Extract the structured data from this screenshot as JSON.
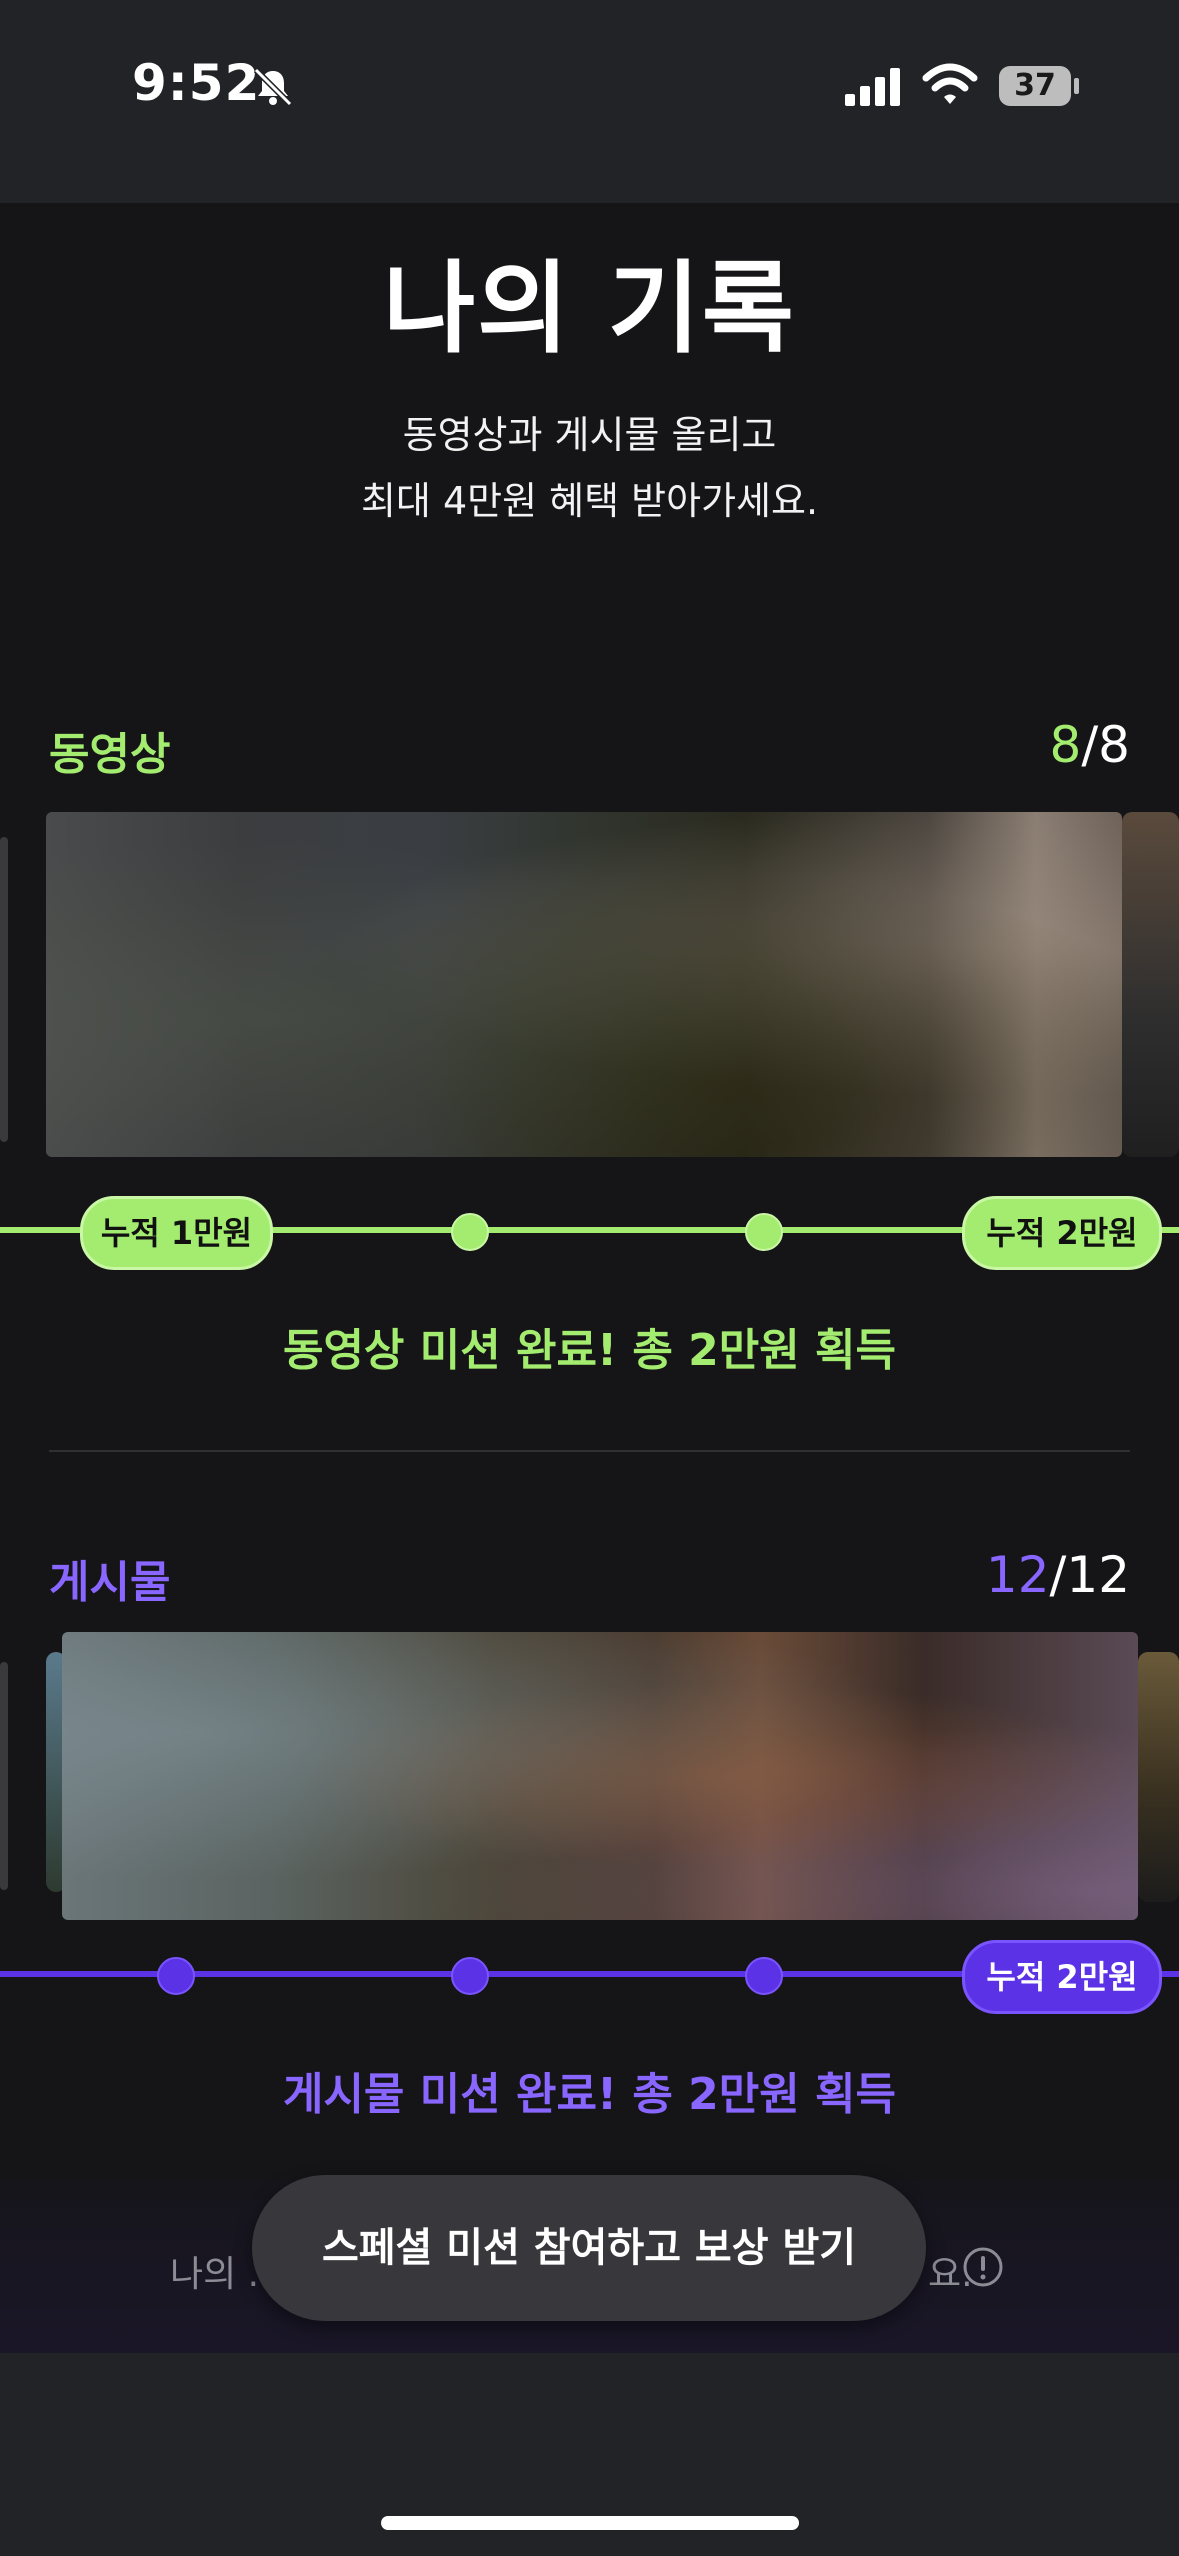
{
  "status_bar": {
    "time": "9:52",
    "battery": "37",
    "icons": [
      "bell-slash-icon",
      "signal-icon",
      "wifi-icon",
      "battery-icon"
    ]
  },
  "header": {
    "title": "나의 기록",
    "subtitle_line1": "동영상과 게시물 올리고",
    "subtitle_line2": "최대 4만원 혜택 받아가세요."
  },
  "video_section": {
    "label": "동영상",
    "count_done": "8",
    "count_total": "/8",
    "milestone_start": "누적 1만원",
    "milestone_end": "누적 2만원",
    "complete_message": "동영상 미션 완료! 총 2만원 획득",
    "accent_color": "#a3ec6f",
    "progress": 1.0
  },
  "post_section": {
    "label": "게시물",
    "count_done": "12",
    "count_total": "/12",
    "milestone_end": "누적 2만원",
    "complete_message": "게시물 미션 완료! 총 2만원 획득",
    "accent_color": "#6a3df0",
    "progress": 1.0
  },
  "bottom": {
    "banner_text_left": "나의 .",
    "banner_text_right": "요.",
    "special_button": "스페셜 미션 참여하고 보상 받기"
  }
}
